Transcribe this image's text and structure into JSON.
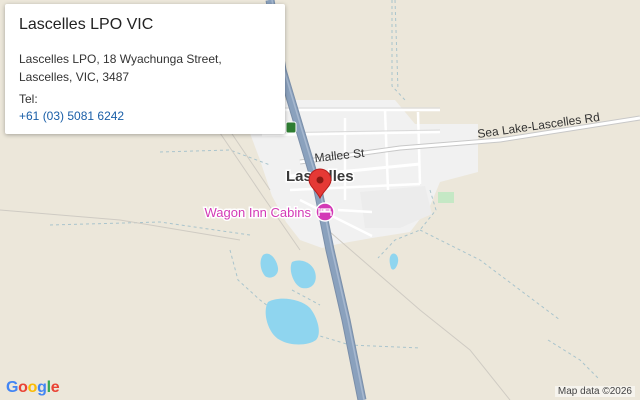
{
  "info_card": {
    "title": "Lascelles LPO VIC",
    "address_line_1": "Lascelles LPO, 18 Wyachunga Street,",
    "address_line_2": "Lascelles, VIC, 3487",
    "tel_label": "Tel:",
    "phone": "+61 (03) 5081 6242"
  },
  "map": {
    "town_label": "Lascelles",
    "road_labels": {
      "mallee_st": "Mallee St",
      "sea_lake_rd": "Sea Lake-Lascelles Rd"
    },
    "poi_label": "Wagon Inn Cabins",
    "route_shield": "",
    "colors": {
      "land": "#ece7da",
      "town_area": "#f1f1f1",
      "water": "#8fd5ef",
      "highway": "#8aa1bd",
      "poi": "#d33ab6",
      "marker": "#e53935",
      "park": "#c5e8c5"
    }
  },
  "footer": {
    "logo_letters": [
      "G",
      "o",
      "o",
      "g",
      "l",
      "e"
    ],
    "attribution": "Map data ©2026"
  }
}
